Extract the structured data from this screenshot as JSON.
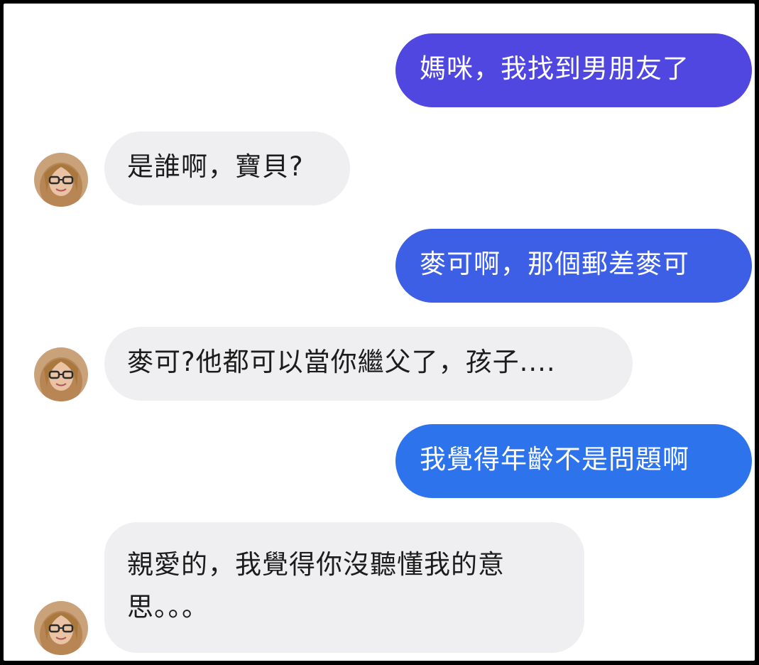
{
  "conversation": {
    "messages": [
      {
        "from": "me",
        "text": "媽咪，我找到男朋友了",
        "color": "#5046e0"
      },
      {
        "from": "mom",
        "text": "是誰啊，寶貝?"
      },
      {
        "from": "me",
        "text": "麥可啊，那個郵差麥可",
        "color": "#3d5fe6"
      },
      {
        "from": "mom",
        "text": "麥可?他都可以當你繼父了，孩子...."
      },
      {
        "from": "me",
        "text": "我覺得年齡不是問題啊",
        "color": "#2d73ec"
      },
      {
        "from": "mom",
        "text_line1": "親愛的，我覺得你沒聽懂我的意",
        "text_line2": "思。。。"
      }
    ]
  },
  "contact": {
    "avatar_icon": "woman-with-glasses-avatar"
  }
}
